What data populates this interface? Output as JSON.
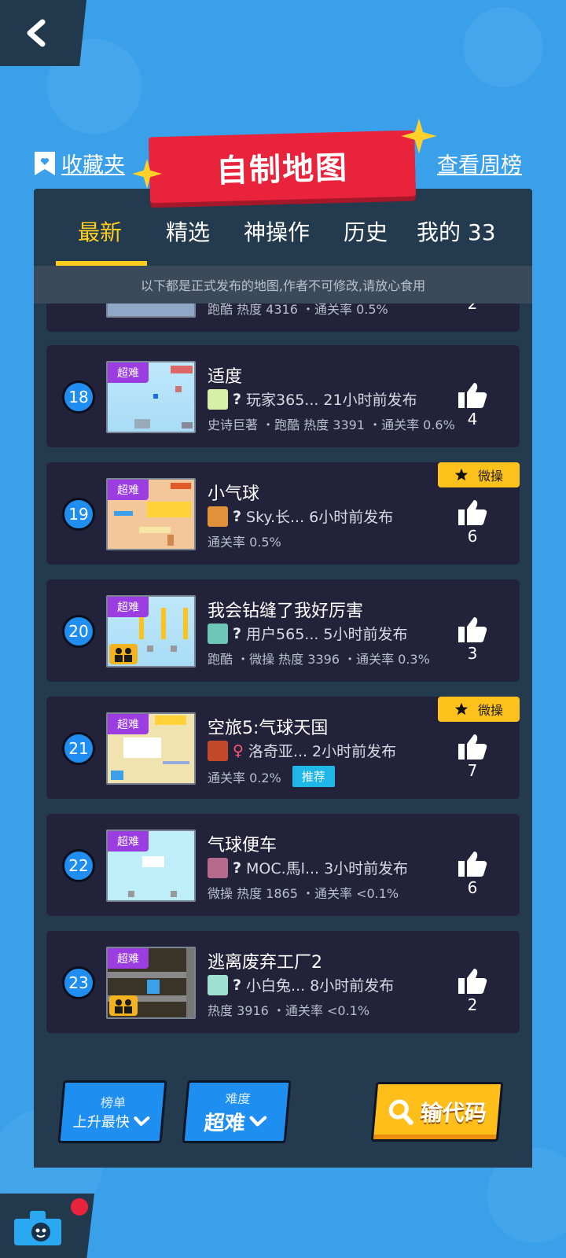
{
  "header": {
    "back_icon": "chevron-left-icon",
    "favorites_label": "收藏夹",
    "weekly_label": "查看周榜",
    "title": "自制地图"
  },
  "tabs": [
    {
      "label": "最新",
      "active": true
    },
    {
      "label": "精选",
      "active": false
    },
    {
      "label": "神操作",
      "active": false
    },
    {
      "label": "历史",
      "active": false
    },
    {
      "label": "我的 33",
      "active": false
    }
  ],
  "notice": "以下都是正式发布的地图,作者不可修改,请放心食用",
  "partial_card": {
    "tags": "跑酷 热度 4316 ・通关率 0.5%",
    "likes": "2"
  },
  "maps": [
    {
      "rank": "18",
      "difficulty": "超难",
      "title": "适度",
      "gender": "?",
      "author": "玩家365...",
      "time": "21小时前发布",
      "tags": "史诗巨著 ・跑酷 热度 3391 ・通关率 0.6%",
      "likes": "4",
      "badge": "",
      "recommend": "",
      "coop": false
    },
    {
      "rank": "19",
      "difficulty": "超难",
      "title": "小气球",
      "gender": "?",
      "author": "Sky.长...",
      "time": "6小时前发布",
      "tags": "通关率 0.5%",
      "likes": "6",
      "badge": "微操",
      "recommend": "",
      "coop": false
    },
    {
      "rank": "20",
      "difficulty": "超难",
      "title": "我会钻缝了我好厉害",
      "gender": "?",
      "author": "用户565...",
      "time": "5小时前发布",
      "tags": "跑酷 ・微操 热度 3396 ・通关率 0.3%",
      "likes": "3",
      "badge": "",
      "recommend": "",
      "coop": true
    },
    {
      "rank": "21",
      "difficulty": "超难",
      "title": "空旅5:气球天国",
      "gender": "♀",
      "author": "洛奇亚...",
      "time": "2小时前发布",
      "tags": "通关率 0.2%",
      "likes": "7",
      "badge": "微操",
      "recommend": "推荐",
      "coop": false
    },
    {
      "rank": "22",
      "difficulty": "超难",
      "title": "气球便车",
      "gender": "?",
      "author": "MOC.馬l...",
      "time": "3小时前发布",
      "tags": "微操 热度 1865 ・通关率 <0.1%",
      "likes": "6",
      "badge": "",
      "recommend": "",
      "coop": false
    },
    {
      "rank": "23",
      "difficulty": "超难",
      "title": "逃离废弃工厂2",
      "gender": "?",
      "author": "小白兔...",
      "time": "8小时前发布",
      "tags": "热度 3916 ・通关率 <0.1%",
      "likes": "2",
      "badge": "",
      "recommend": "",
      "coop": true
    }
  ],
  "bottom": {
    "sort_label": "榜单",
    "sort_value": "上升最快",
    "difficulty_label": "难度",
    "difficulty_value": "超难",
    "code_label": "输代码"
  },
  "colors": {
    "background": "#3aa0ea",
    "panel": "#233a4f",
    "card": "#22223a",
    "accent_yellow": "#ffcd1e",
    "banner_red": "#e8233b",
    "difficulty_purple": "#9b3de0",
    "rank_blue": "#1f8ef0"
  }
}
